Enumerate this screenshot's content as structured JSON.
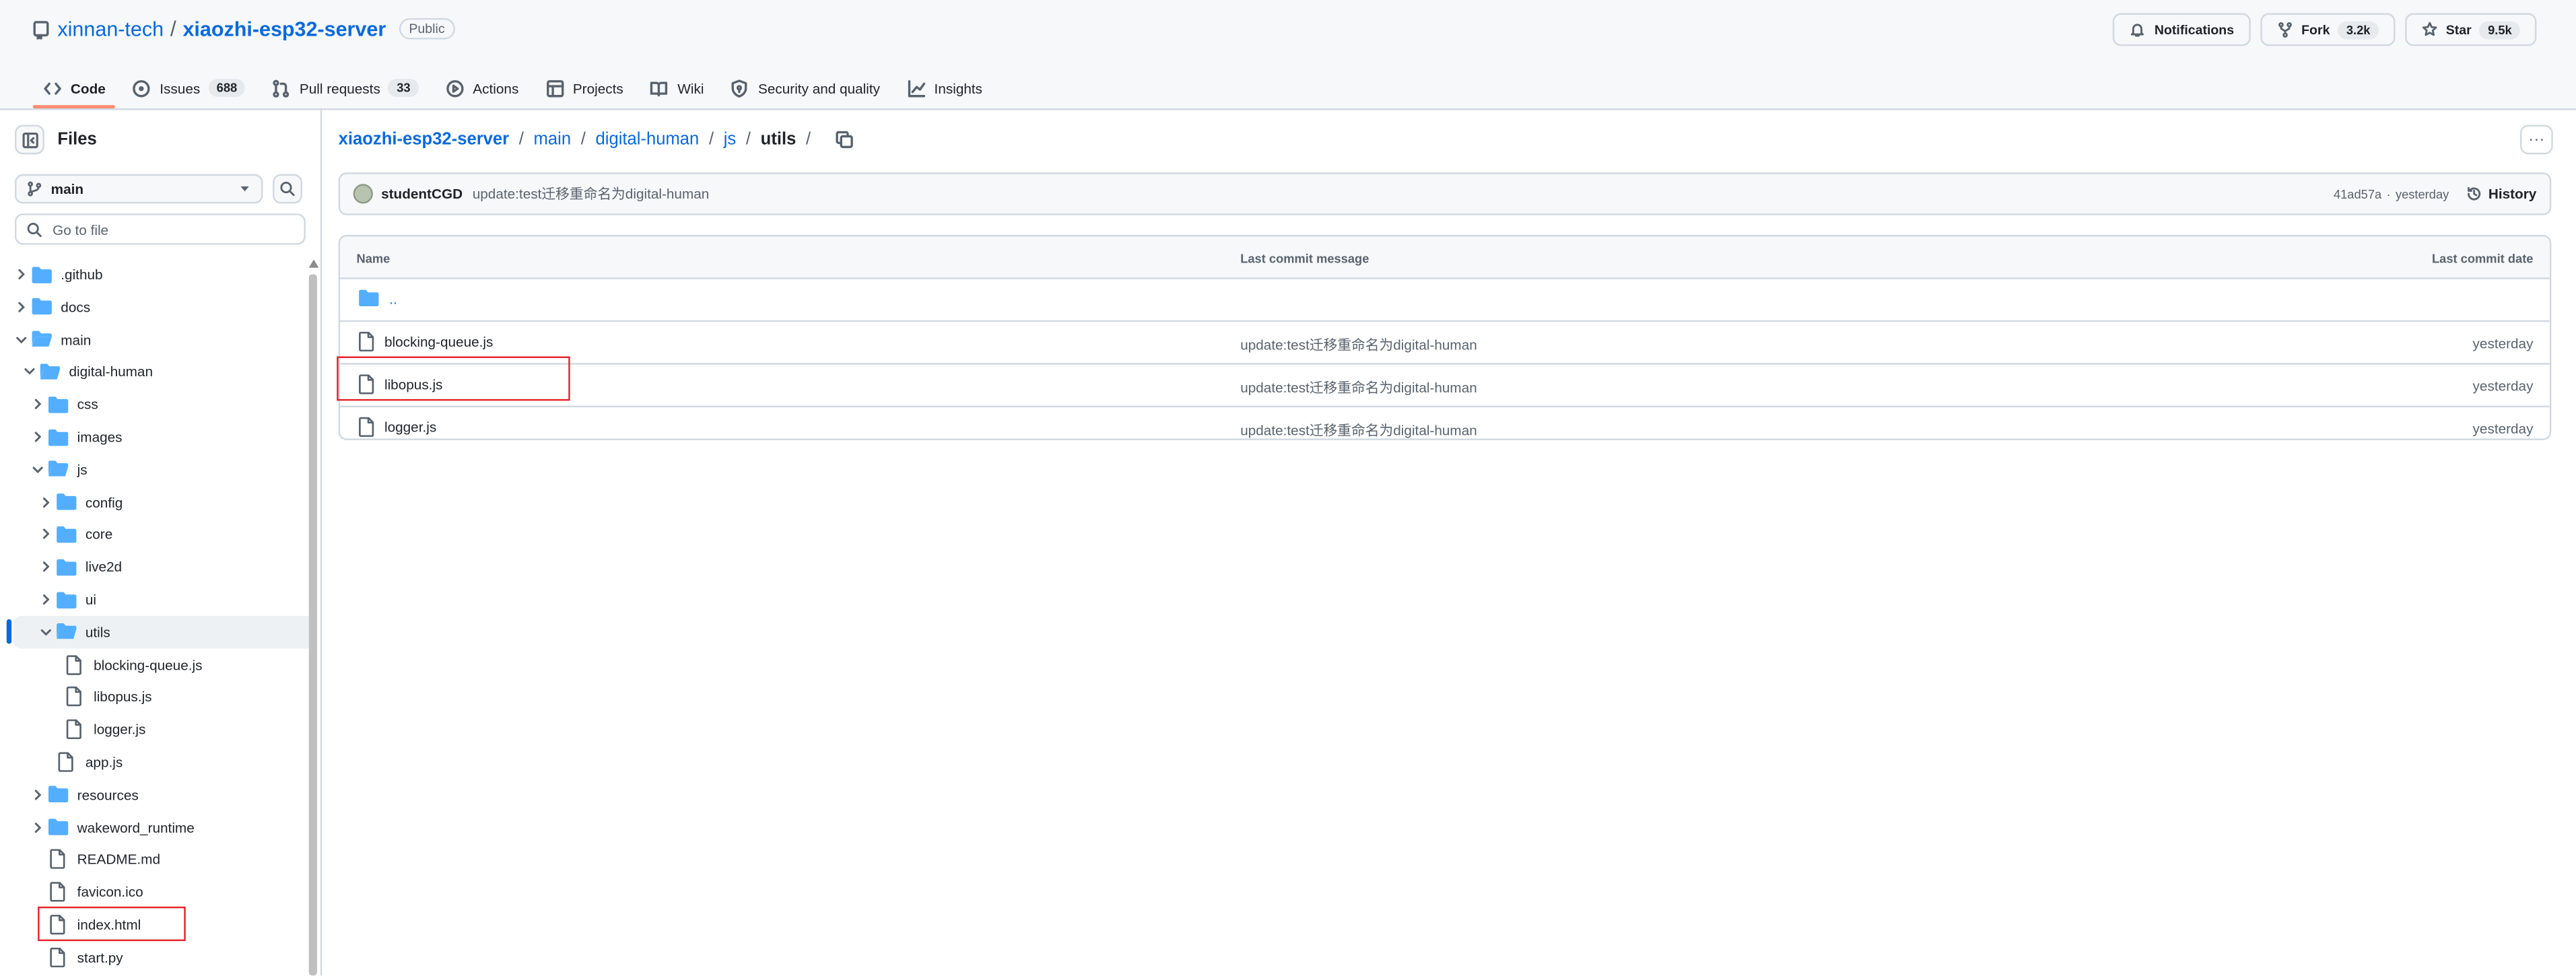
{
  "header": {
    "owner": "xinnan-tech",
    "separator": "/",
    "repo": "xiaozhi-esp32-server",
    "visibility": "Public",
    "notifications_label": "Notifications",
    "fork_label": "Fork",
    "fork_count": "3.2k",
    "star_label": "Star",
    "star_count": "9.5k",
    "tabs": [
      {
        "label": "Code",
        "icon": "code-icon",
        "count": ""
      },
      {
        "label": "Issues",
        "icon": "issue-icon",
        "count": "688"
      },
      {
        "label": "Pull requests",
        "icon": "pull-request-icon",
        "count": "33"
      },
      {
        "label": "Actions",
        "icon": "play-icon",
        "count": ""
      },
      {
        "label": "Projects",
        "icon": "table-icon",
        "count": ""
      },
      {
        "label": "Wiki",
        "icon": "book-icon",
        "count": ""
      },
      {
        "label": "Security and quality",
        "icon": "shield-icon",
        "count": ""
      },
      {
        "label": "Insights",
        "icon": "graph-icon",
        "count": ""
      }
    ]
  },
  "sidebar": {
    "title": "Files",
    "branch": "main",
    "goto_placeholder": "Go to file",
    "tree": [
      {
        "label": ".github",
        "type": "folder",
        "depth": 0,
        "expanded": false
      },
      {
        "label": "docs",
        "type": "folder",
        "depth": 0,
        "expanded": false
      },
      {
        "label": "main",
        "type": "folder",
        "depth": 0,
        "expanded": true
      },
      {
        "label": "digital-human",
        "type": "folder",
        "depth": 1,
        "expanded": true
      },
      {
        "label": "css",
        "type": "folder",
        "depth": 2,
        "expanded": false
      },
      {
        "label": "images",
        "type": "folder",
        "depth": 2,
        "expanded": false
      },
      {
        "label": "js",
        "type": "folder",
        "depth": 2,
        "expanded": true
      },
      {
        "label": "config",
        "type": "folder",
        "depth": 3,
        "expanded": false
      },
      {
        "label": "core",
        "type": "folder",
        "depth": 3,
        "expanded": false
      },
      {
        "label": "live2d",
        "type": "folder",
        "depth": 3,
        "expanded": false
      },
      {
        "label": "ui",
        "type": "folder",
        "depth": 3,
        "expanded": false
      },
      {
        "label": "utils",
        "type": "folder",
        "depth": 3,
        "expanded": true,
        "selected": true
      },
      {
        "label": "blocking-queue.js",
        "type": "file",
        "depth": 4
      },
      {
        "label": "libopus.js",
        "type": "file",
        "depth": 4
      },
      {
        "label": "logger.js",
        "type": "file",
        "depth": 4
      },
      {
        "label": "app.js",
        "type": "file",
        "depth": 3
      },
      {
        "label": "resources",
        "type": "folder",
        "depth": 2,
        "expanded": false
      },
      {
        "label": "wakeword_runtime",
        "type": "folder",
        "depth": 2,
        "expanded": false
      },
      {
        "label": "README.md",
        "type": "file",
        "depth": 2
      },
      {
        "label": "favicon.ico",
        "type": "file",
        "depth": 2
      },
      {
        "label": "index.html",
        "type": "file",
        "depth": 2
      },
      {
        "label": "start.py",
        "type": "file",
        "depth": 2
      }
    ]
  },
  "breadcrumb": {
    "items": [
      "xiaozhi-esp32-server",
      "main",
      "digital-human",
      "js"
    ],
    "current": "utils",
    "separator": "/"
  },
  "commit": {
    "author": "studentCGD",
    "message": "update:test迁移重命名为digital-human",
    "hash": "41ad57a",
    "dot": "·",
    "time": "yesterday",
    "history_label": "History"
  },
  "table": {
    "headers": {
      "name": "Name",
      "message": "Last commit message",
      "date": "Last commit date"
    },
    "parent": "..",
    "rows": [
      {
        "name": "blocking-queue.js",
        "message": "update:test迁移重命名为digital-human",
        "date": "yesterday"
      },
      {
        "name": "libopus.js",
        "message": "update:test迁移重命名为digital-human",
        "date": "yesterday"
      },
      {
        "name": "logger.js",
        "message": "update:test迁移重命名为digital-human",
        "date": "yesterday"
      }
    ]
  },
  "colors": {
    "accent": "#0969da",
    "folder": "#54aeff",
    "highlight_box": "#e5232a",
    "tab_underline": "#fd8c73"
  }
}
